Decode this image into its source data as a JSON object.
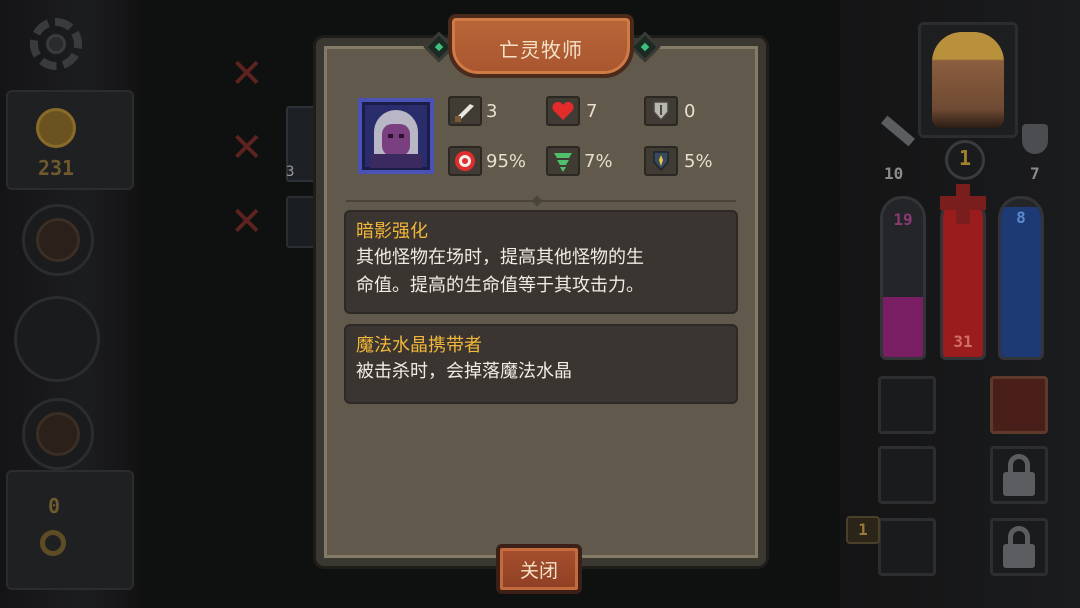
{
  "dialog": {
    "title": "亡灵牧师",
    "close_label": "关闭",
    "stats": {
      "attack": "3",
      "health": "7",
      "armor": "0",
      "accuracy": "95%",
      "evasion": "7%",
      "block": "5%"
    },
    "abilities": [
      {
        "name": "暗影强化",
        "desc_line1": "其他怪物在场时，提高其他怪物的生",
        "desc_line2": "命值。提高的生命值等于其攻击力。"
      },
      {
        "name": "魔法水晶携带者",
        "desc_line1": "被击杀时，会掉落魔法水晶"
      }
    ]
  },
  "hud": {
    "gold": "231",
    "keys": "0",
    "player_level": "1",
    "player_attack": "10",
    "player_armor": "7",
    "mana_left": "19",
    "health": "31",
    "mana_right": "8",
    "enemy_slot_count": "3",
    "item_count": "1"
  },
  "colors": {
    "panel_bg": "#615a4c",
    "ability_title": "#f2b73a",
    "title_plate": "#b9663a",
    "mana_purple": "#7a1e63",
    "health_red": "#9a1c1c",
    "mana_blue": "#1e3a74"
  }
}
